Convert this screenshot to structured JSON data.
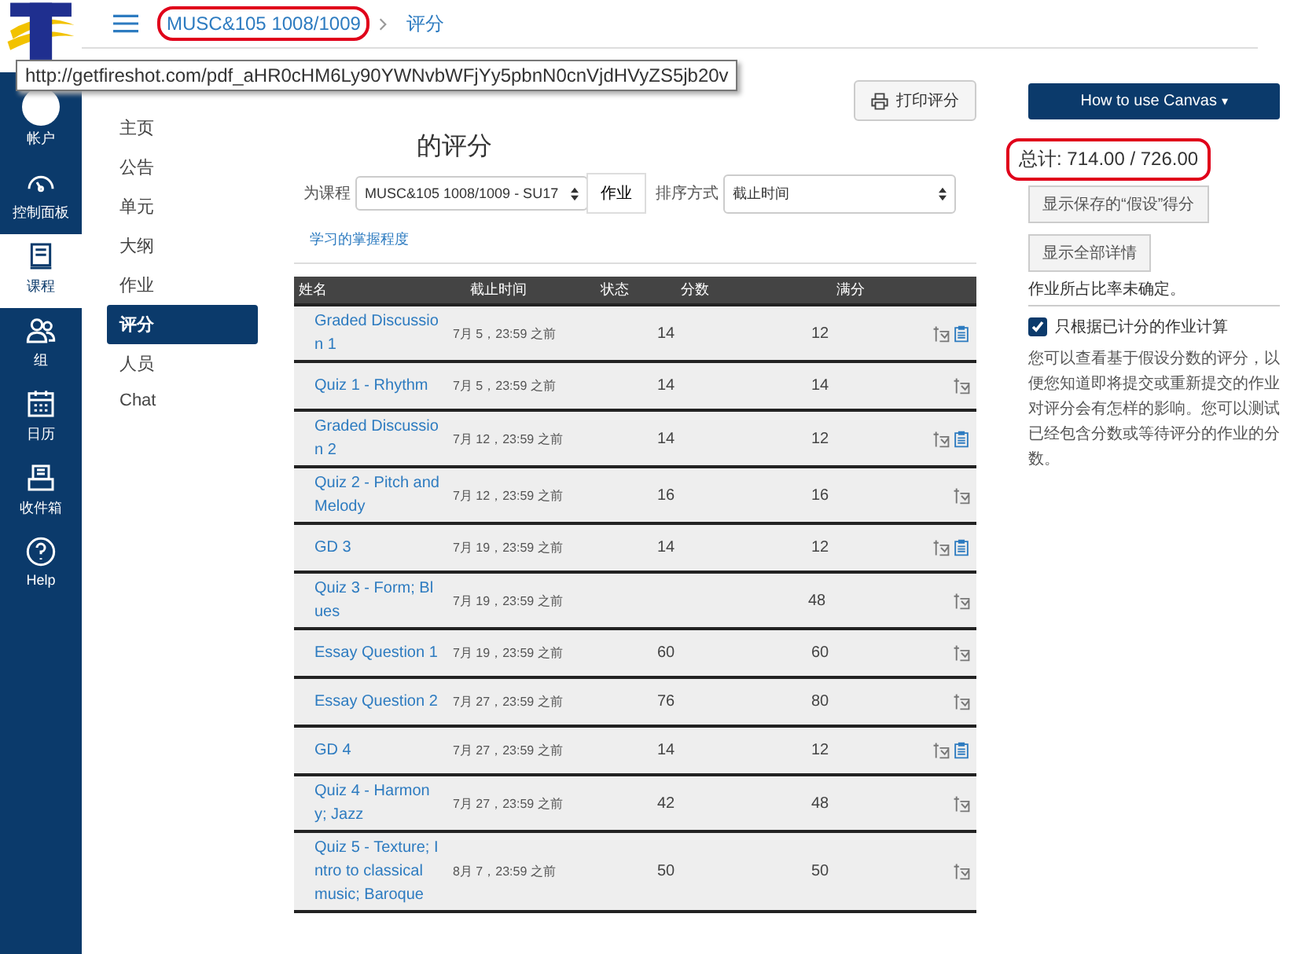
{
  "breadcrumb": [
    {
      "label": "MUSC&105 1008/1009",
      "highlighted": true
    },
    {
      "label": "评分",
      "highlighted": false
    }
  ],
  "tooltip": "http://getfireshot.com/pdf_aHR0cHM6Ly90YWNvbWFjYy5pbnN0cnVjdHVyZS5jb20v",
  "global_nav": [
    {
      "label": "帐户",
      "kind": "account",
      "selected": false
    },
    {
      "label": "控制面板",
      "kind": "dashboard",
      "selected": false
    },
    {
      "label": "课程",
      "kind": "courses",
      "selected": true
    },
    {
      "label": "组",
      "kind": "groups",
      "selected": false
    },
    {
      "label": "日历",
      "kind": "calendar",
      "selected": false
    },
    {
      "label": "收件箱",
      "kind": "inbox",
      "selected": false
    },
    {
      "label": "Help",
      "kind": "help",
      "selected": false
    }
  ],
  "course_nav": [
    {
      "label": "主页",
      "selected": false
    },
    {
      "label": "公告",
      "selected": false
    },
    {
      "label": "单元",
      "selected": false
    },
    {
      "label": "大纲",
      "selected": false
    },
    {
      "label": "作业",
      "selected": false
    },
    {
      "label": "评分",
      "selected": true
    },
    {
      "label": "人员",
      "selected": false
    },
    {
      "label": "Chat",
      "selected": false
    }
  ],
  "title": "的评分",
  "print_button": "打印评分",
  "filters": {
    "course_label": "为课程",
    "course_value": "MUSC&105 1008/1009 - SU17",
    "apply_button": "作业",
    "sort_label": "排序方式",
    "sort_value": "截止时间"
  },
  "mastery_link": "学习的掌握程度",
  "table": {
    "columns": [
      "姓名",
      "截止时间",
      "状态",
      "分数",
      "满分"
    ],
    "rows": [
      {
        "name": "Graded Discussion 1",
        "due": "7月 5，23:59 之前",
        "score": "14",
        "out_of": "12",
        "rubric": true
      },
      {
        "name": "Quiz 1 - Rhythm",
        "due": "7月 5，23:59 之前",
        "score": "14",
        "out_of": "14",
        "rubric": false
      },
      {
        "name": "Graded Discussion 2",
        "due": "7月 12，23:59 之前",
        "score": "14",
        "out_of": "12",
        "rubric": true
      },
      {
        "name": "Quiz 2 - Pitch and Melody",
        "due": "7月 12，23:59 之前",
        "score": "16",
        "out_of": "16",
        "rubric": false
      },
      {
        "name": "GD 3",
        "due": "7月 19，23:59 之前",
        "score": "14",
        "out_of": "12",
        "rubric": true
      },
      {
        "name": "Quiz 3 - Form; Blues",
        "due": "7月 19，23:59 之前",
        "out_of": "48",
        "rubric": false
      },
      {
        "name": "Essay Question 1",
        "due": "7月 19，23:59 之前",
        "score": "60",
        "out_of": "60",
        "rubric": false
      },
      {
        "name": "Essay Question 2",
        "due": "7月 27，23:59 之前",
        "score": "76",
        "out_of": "80",
        "rubric": false
      },
      {
        "name": "GD 4",
        "due": "7月 27，23:59 之前",
        "score": "14",
        "out_of": "12",
        "rubric": true
      },
      {
        "name": "Quiz 4 - Harmony; Jazz",
        "due": "7月 27，23:59 之前",
        "score": "42",
        "out_of": "48",
        "rubric": false
      },
      {
        "name": "Quiz 5 - Texture; Intro to classical music; Baroque",
        "due": "8月 7，23:59 之前",
        "score": "50",
        "out_of": "50",
        "rubric": false
      }
    ]
  },
  "sidebar": {
    "help_button": "How to use Canvas",
    "help_caret": "▾",
    "total": "总计: 714.00 / 726.00",
    "total_highlighted": true,
    "whatif_button": "显示保存的“假设”得分",
    "details_button": "显示全部详情",
    "weight_note": "作业所占比率未确定。",
    "graded_only": {
      "label": "只根据已计分的作业计算",
      "checked": true
    },
    "info": "您可以查看基于假设分数的评分，以便您知道即将提交或重新提交的作业对评分会有怎样的影响。您可以测试已经包含分数或等待评分的作业的分数。"
  }
}
